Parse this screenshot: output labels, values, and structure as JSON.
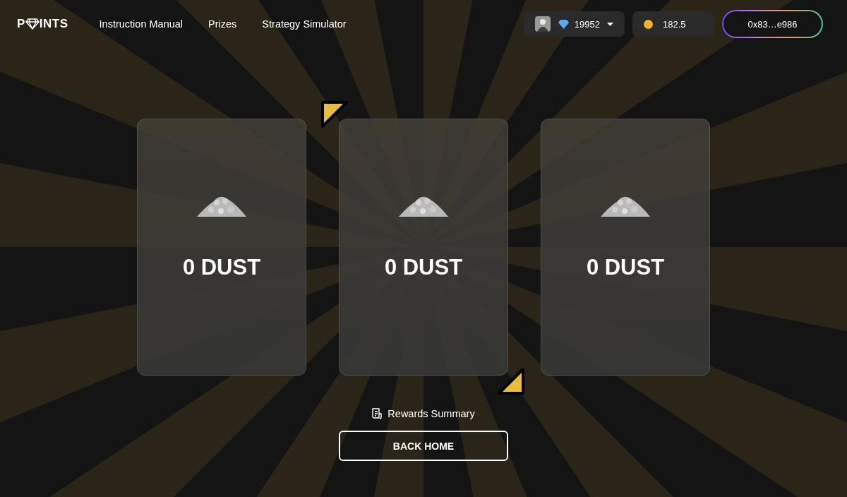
{
  "logo": {
    "before": "P",
    "after": "INTS"
  },
  "nav": [
    "Instruction Manual",
    "Prizes",
    "Strategy Simulator"
  ],
  "gems": {
    "value": "19952"
  },
  "coins": {
    "value": "182.5"
  },
  "wallet": {
    "address": "0x83…e986"
  },
  "cards": [
    {
      "amount": "0 DUST"
    },
    {
      "amount": "0 DUST"
    },
    {
      "amount": "0 DUST"
    }
  ],
  "summary_link": "Rewards Summary",
  "back_button": "BACK HOME"
}
